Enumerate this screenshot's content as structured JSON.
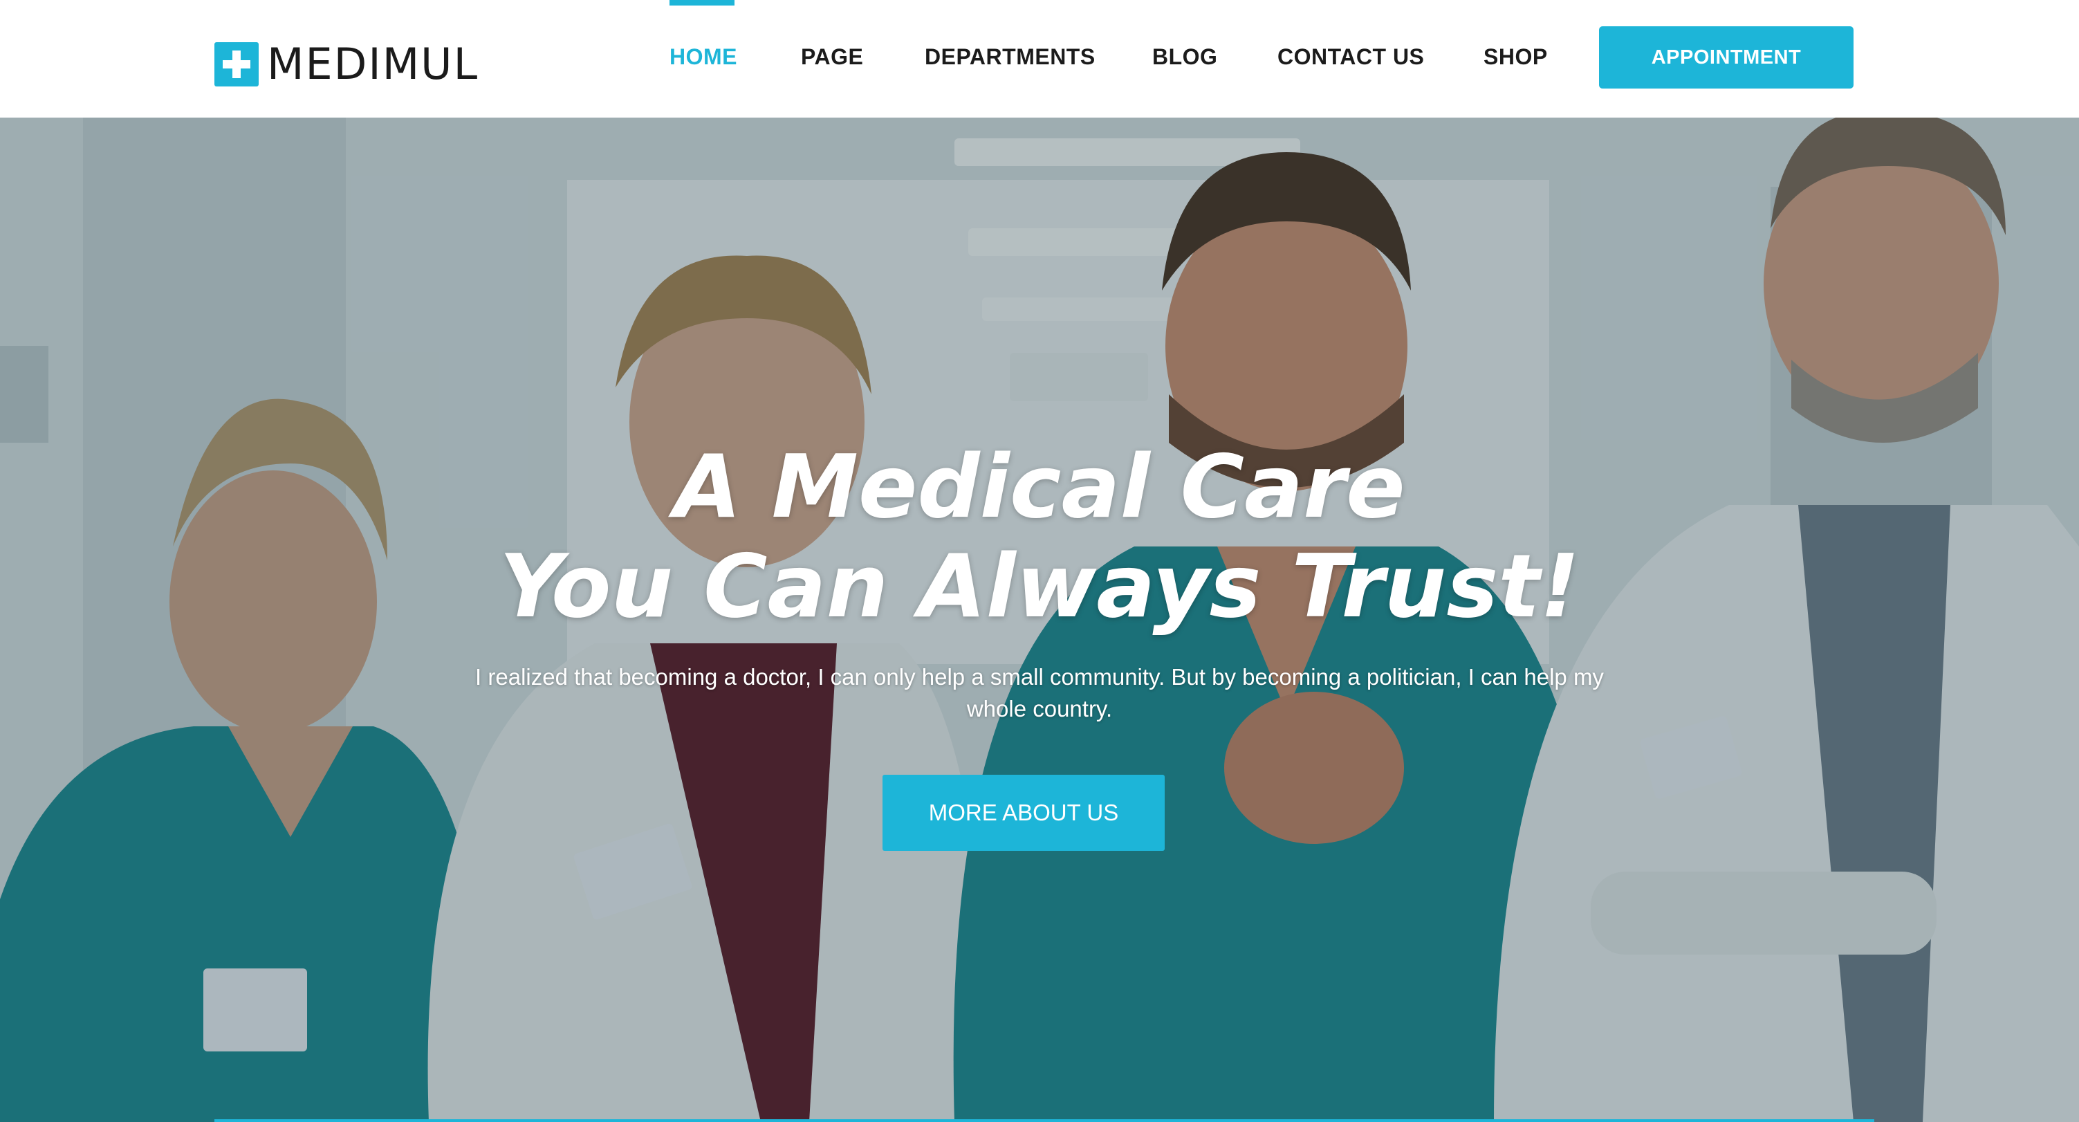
{
  "brand": {
    "name": "MEDIMUL",
    "accent_color": "#1db5d8",
    "logo_icon": "medical-cross-icon"
  },
  "nav": {
    "items": [
      {
        "label": "HOME",
        "active": true
      },
      {
        "label": "PAGE",
        "active": false
      },
      {
        "label": "DEPARTMENTS",
        "active": false
      },
      {
        "label": "BLOG",
        "active": false
      },
      {
        "label": "CONTACT US",
        "active": false
      },
      {
        "label": "SHOP",
        "active": false
      }
    ],
    "cta_label": "APPOINTMENT"
  },
  "hero": {
    "title_line1": "A Medical Care",
    "title_line2": "You Can Always Trust!",
    "text": "I realized that becoming a doctor, I can only help a small community. But by becoming a politician, I can help my whole country.",
    "button_label": "MORE ABOUT US",
    "background": "photo of four smiling medical staff in a hospital corridor"
  }
}
